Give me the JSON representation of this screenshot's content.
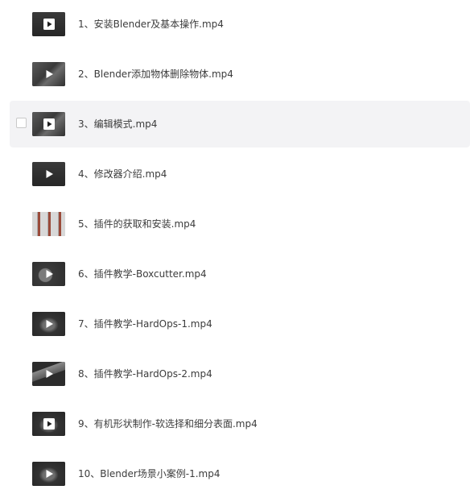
{
  "files": [
    {
      "name": "1、安装Blender及基本操作.mp4",
      "thumb": "dark",
      "play_style": "white-box"
    },
    {
      "name": "2、Blender添加物体删除物体.mp4",
      "thumb": "gray-scene",
      "play_style": "triangle"
    },
    {
      "name": "3、编辑模式.mp4",
      "thumb": "gray-scene",
      "play_style": "white-box",
      "hovered": true
    },
    {
      "name": "4、修改器介绍.mp4",
      "thumb": "dark",
      "play_style": "triangle"
    },
    {
      "name": "5、插件的获取和安装.mp4",
      "thumb": "light-grid",
      "play_style": "none"
    },
    {
      "name": "6、插件教学-Boxcutter.mp4",
      "thumb": "dark-sphere",
      "play_style": "triangle"
    },
    {
      "name": "7、插件教学-HardOps-1.mp4",
      "thumb": "dark-object",
      "play_style": "triangle"
    },
    {
      "name": "8、插件教学-HardOps-2.mp4",
      "thumb": "dark-cube",
      "play_style": "triangle"
    },
    {
      "name": "9、有机形状制作-软选择和细分表面.mp4",
      "thumb": "dark-object",
      "play_style": "white-box"
    },
    {
      "name": "10、Blender场景小案例-1.mp4",
      "thumb": "dark-object",
      "play_style": "triangle"
    }
  ],
  "watermark": "",
  "colors": {
    "text": "#3c3c3c",
    "hover_bg": "#f3f3f5",
    "thumb_dark": "#2e2e2e"
  },
  "icons": {
    "play": "play-icon",
    "checkbox": "checkbox-icon"
  }
}
